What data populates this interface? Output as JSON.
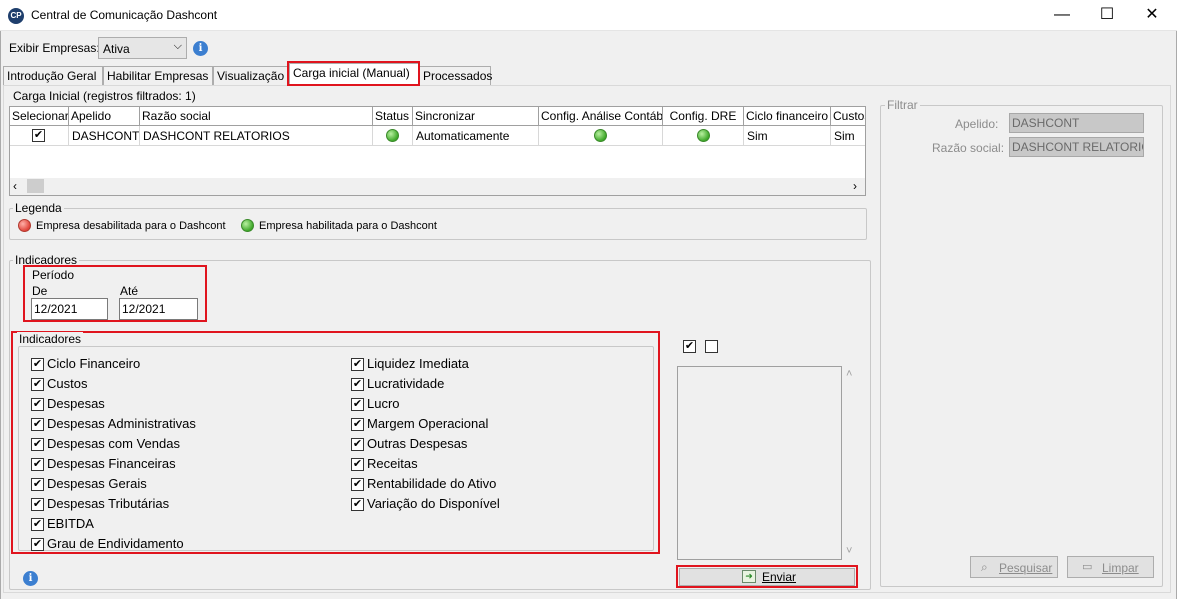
{
  "window": {
    "title": "Central de Comunicação Dashcont",
    "icon_text": "CP",
    "minimize": "—",
    "maximize": "☐",
    "close": "✕"
  },
  "exibir": {
    "label": "Exibir Empresas:",
    "value": "Ativa"
  },
  "tabs": [
    {
      "label": "Introdução Geral"
    },
    {
      "label": "Habilitar Empresas"
    },
    {
      "label": "Visualização"
    },
    {
      "label": "Carga inicial (Manual)"
    },
    {
      "label": "Processados"
    }
  ],
  "carga": {
    "group_label": "Carga Inicial (registros filtrados: 1)",
    "columns": [
      "Selecionar",
      "Apelido",
      "Razão social",
      "Status",
      "Sincronizar",
      "Config. Análise Contábi",
      "Config. DRE",
      "Ciclo financeiro",
      "Custos"
    ],
    "row": {
      "selecionar": "✔",
      "apelido": "DASHCONT",
      "razao": "DASHCONT RELATORIOS",
      "status": "green",
      "sincronizar": "Automaticamente",
      "config_analise": "green",
      "config_dre": "green",
      "ciclo": "Sim",
      "custos": "Sim"
    }
  },
  "legenda": {
    "label": "Legenda",
    "disabled": "Empresa desabilitada para o Dashcont",
    "enabled": "Empresa habilitada para o Dashcont"
  },
  "indicadores": {
    "group_label": "Indicadores",
    "periodo_label": "Período",
    "de_label": "De",
    "de_value": "12/2021",
    "ate_label": "Até",
    "ate_value": "12/2021",
    "list_label": "Indicadores",
    "col1": [
      "Ciclo Financeiro",
      "Custos",
      "Despesas",
      "Despesas Administrativas",
      "Despesas com Vendas",
      "Despesas Financeiras",
      "Despesas Gerais",
      "Despesas Tributárias",
      "EBITDA",
      "Grau de Endividamento"
    ],
    "col2": [
      "Liquidez Imediata",
      "Lucratividade",
      "Lucro",
      "Margem Operacional",
      "Outras Despesas",
      "Receitas",
      "Rentabilidade do Ativo",
      "Variação do Disponível"
    ],
    "checked": "✔"
  },
  "enviar_label": "Enviar",
  "filtrar": {
    "label": "Filtrar",
    "apelido_label": "Apelido:",
    "apelido_value": "DASHCONT",
    "razao_label": "Razão social:",
    "razao_value": "DASHCONT RELATORIOS",
    "pesquisar": "Pesquisar",
    "limpar": "Limpar"
  },
  "colors": {
    "accent_red": "#e0141e",
    "status_green": "#3fa82a",
    "status_red": "#e0443a"
  }
}
